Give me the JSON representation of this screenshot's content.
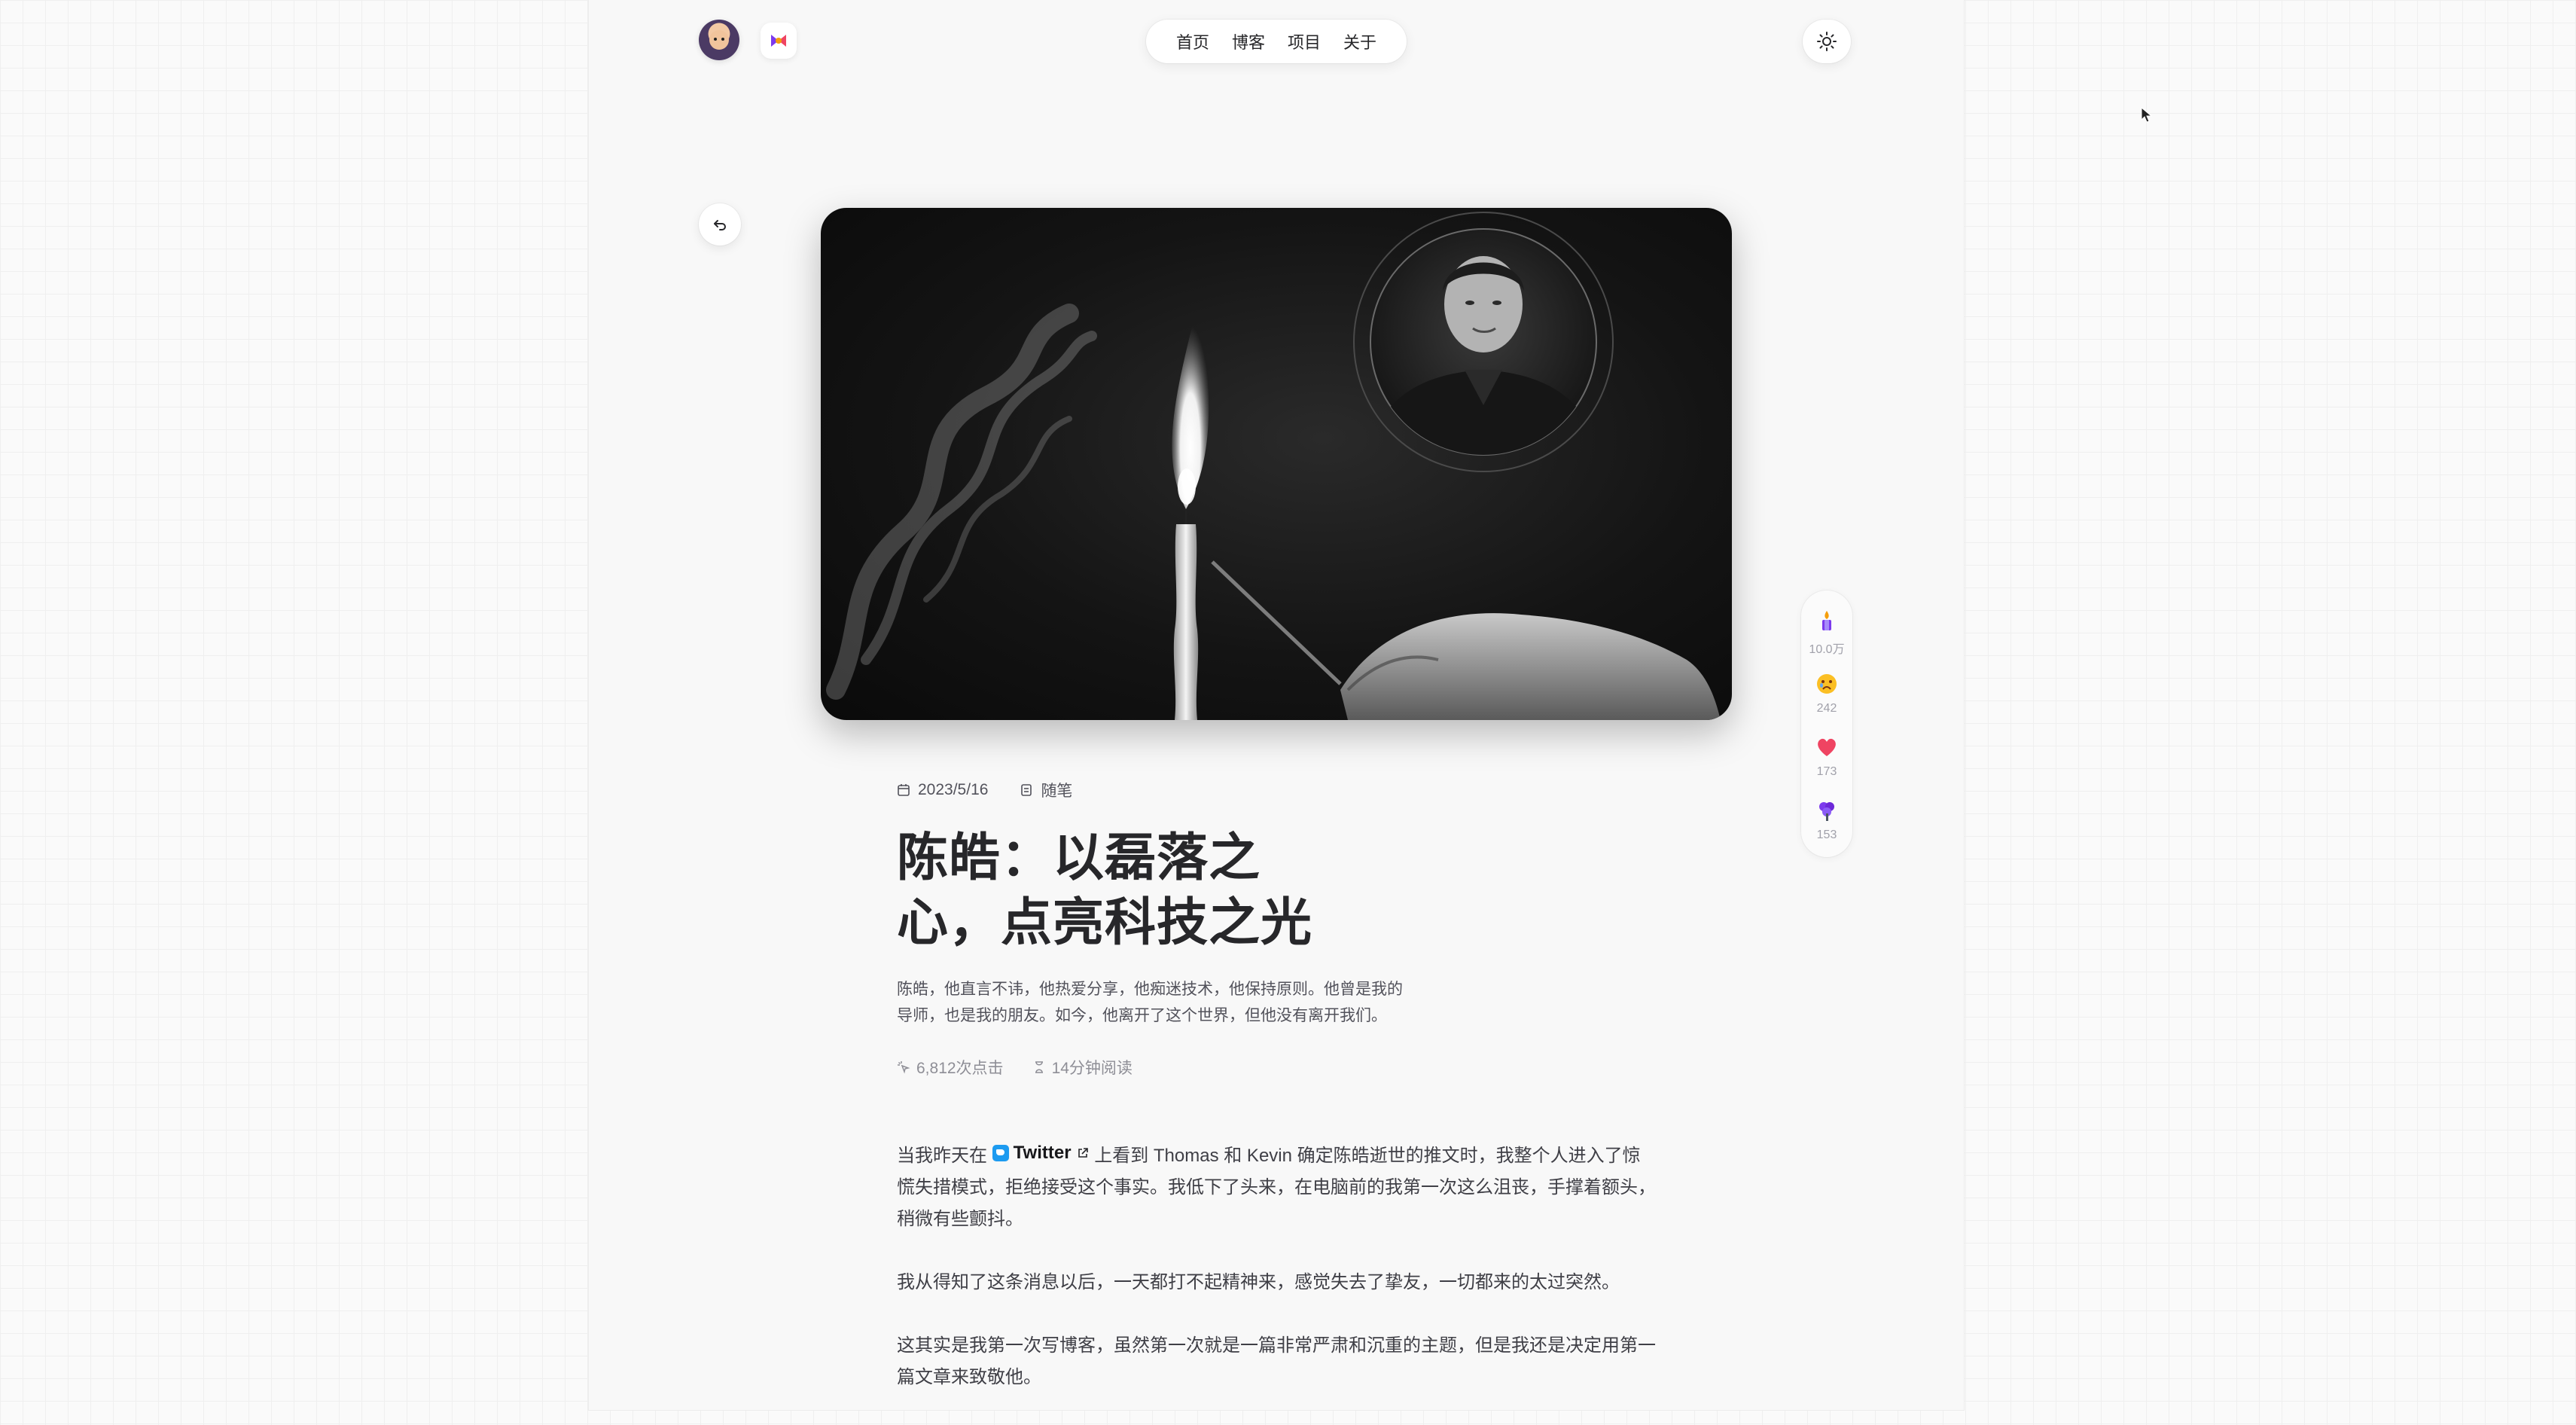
{
  "nav": {
    "items": [
      {
        "label": "首页"
      },
      {
        "label": "博客"
      },
      {
        "label": "项目"
      },
      {
        "label": "关于"
      }
    ]
  },
  "icons": {
    "avatar": "avatar",
    "logo": "logo-icon",
    "theme": "sun-icon",
    "back": "back-arrow-icon"
  },
  "reactions": [
    {
      "icon": "candle-emoji",
      "count": "10.0万"
    },
    {
      "icon": "crying-face-emoji",
      "count": "242"
    },
    {
      "icon": "heart-emoji",
      "count": "173"
    },
    {
      "icon": "flower-emoji",
      "count": "153"
    }
  ],
  "post": {
    "date": "2023/5/16",
    "category": "随笔",
    "title_line1": "陈皓：以磊落之",
    "title_line2": "心，点亮科技之光",
    "description": "陈皓，他直言不讳，他热爱分享，他痴迷技术，他保持原则。他曾是我的导师，也是我的朋友。如今，他离开了这个世界，但他没有离开我们。",
    "views": "6,812次点击",
    "read_time": "14分钟阅读",
    "body": {
      "p1_before": "当我昨天在",
      "p1_link": "Twitter",
      "p1_after": "上看到 Thomas 和 Kevin 确定陈皓逝世的推文时，我整个人进入了惊慌失措模式，拒绝接受这个事实。我低下了头来，在电脑前的我第一次这么沮丧，手撑着额头，稍微有些颤抖。",
      "p2": "我从得知了这条消息以后，一天都打不起精神来，感觉失去了挚友，一切都来的太过突然。",
      "p3": "这其实是我第一次写博客，虽然第一次就是一篇非常严肃和沉重的主题，但是我还是决定用第一篇文章来致敬他。"
    }
  },
  "colors": {
    "accent_twitter": "#1d9bf0",
    "heart": "#ef4462"
  }
}
